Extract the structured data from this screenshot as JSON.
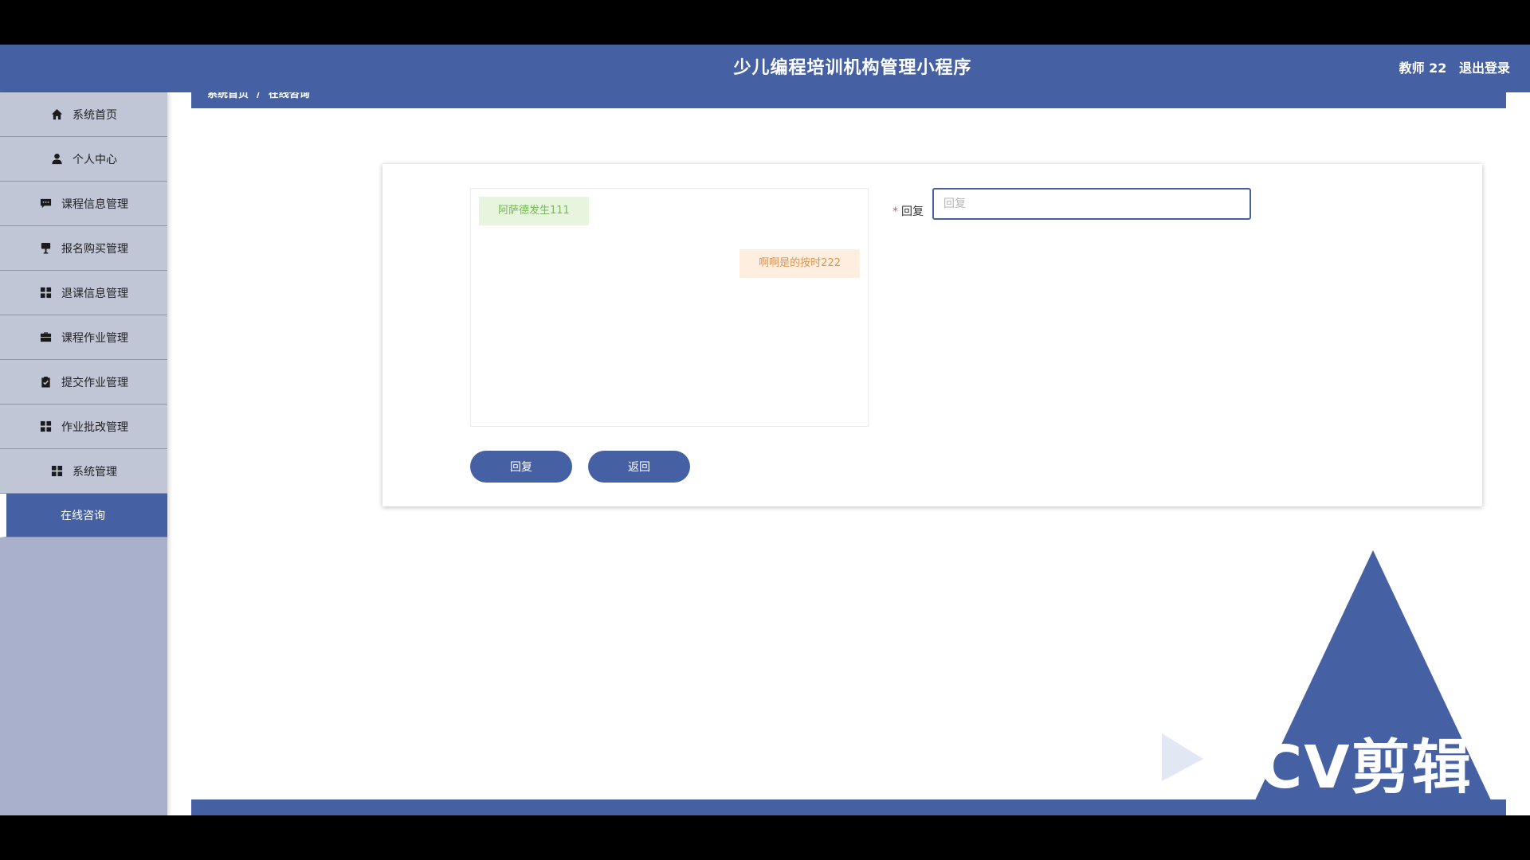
{
  "header": {
    "app_title": "少儿编程培训机构管理小程序",
    "user_name": "教师 22",
    "logout_label": "退出登录"
  },
  "sidebar": {
    "items": [
      {
        "label": "系统首页",
        "icon": "home-icon"
      },
      {
        "label": "个人中心",
        "icon": "user-icon"
      },
      {
        "label": "课程信息管理",
        "icon": "comment-icon"
      },
      {
        "label": "报名购买管理",
        "icon": "sign-icon"
      },
      {
        "label": "退课信息管理",
        "icon": "grid-icon"
      },
      {
        "label": "课程作业管理",
        "icon": "briefcase-icon"
      },
      {
        "label": "提交作业管理",
        "icon": "clipboard-check-icon"
      },
      {
        "label": "作业批改管理",
        "icon": "grid-icon"
      },
      {
        "label": "系统管理",
        "icon": "grid-icon"
      },
      {
        "label": "在线咨询",
        "icon": ""
      }
    ],
    "active_index": 9
  },
  "breadcrumb": {
    "home": "系统首页",
    "separator": "/",
    "current": "在线咨询"
  },
  "chat": {
    "messages": [
      {
        "side": "left",
        "text": "阿萨德发生111"
      },
      {
        "side": "right",
        "text": "啊啊是的按时222"
      }
    ]
  },
  "form": {
    "reply_label": "回复",
    "required_mark": "*",
    "reply_placeholder": "回复",
    "reply_value": ""
  },
  "buttons": {
    "reply_label": "回复",
    "back_label": "返回"
  },
  "watermark": {
    "text": "CV剪辑"
  },
  "colors": {
    "primary": "#4561a3",
    "sidebar_bg": "#a9b0cc",
    "sidebar_item_bg": "#c1c6d7",
    "msg_left_bg": "#e7f4de",
    "msg_left_text": "#79b85a",
    "msg_right_bg": "#fdeee0",
    "msg_right_text": "#dc9552"
  }
}
